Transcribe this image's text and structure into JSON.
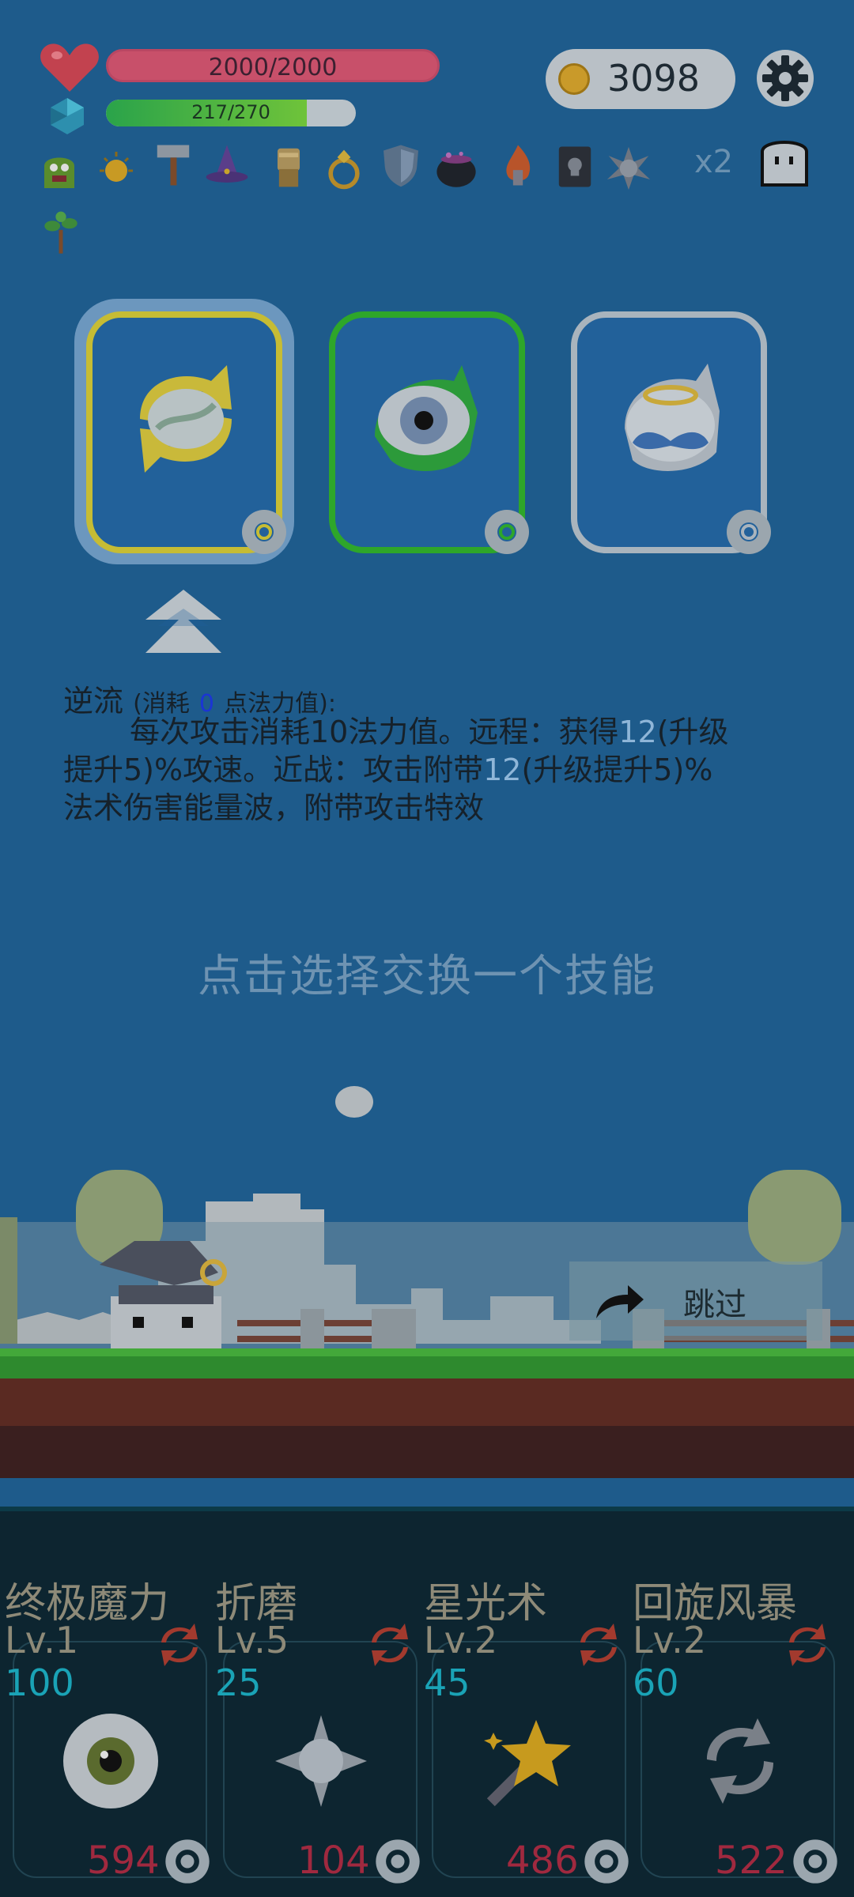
{
  "hud": {
    "hp_text": "2000/2000",
    "hp_fraction": 1.0,
    "mp_text": "217/270",
    "mp_fraction": 0.8037,
    "coins": "3098",
    "multiplier": "x2"
  },
  "equipment": [
    {
      "icon": "green-monster-icon"
    },
    {
      "icon": "sun-orb-icon"
    },
    {
      "icon": "hammer-icon"
    },
    {
      "icon": "wizard-hat-icon"
    },
    {
      "icon": "gauntlet-icon"
    },
    {
      "icon": "ring-icon"
    },
    {
      "icon": "shield-icon"
    },
    {
      "icon": "cauldron-icon"
    },
    {
      "icon": "flame-icon"
    },
    {
      "icon": "skull-book-icon"
    },
    {
      "icon": "spiked-ball-icon"
    },
    {
      "icon": "sapling-icon"
    }
  ],
  "choices": [
    {
      "icon": "reverse-flow-icon",
      "border": "#c6bc34"
    },
    {
      "icon": "eye-icon",
      "border": "#2ea62a"
    },
    {
      "icon": "angel-mustache-icon",
      "border": "#a9b4bd"
    }
  ],
  "description": {
    "name": "逆流",
    "cost_prefix": "(消耗",
    "cost_value": "0",
    "cost_suffix": "点法力值):",
    "line1_a": "每次攻击消耗10法力值。远程：获得",
    "line1_hl": "12",
    "line1_b": "(升级",
    "line2_a": "提升5)%攻速。近战：攻击附带",
    "line2_hl": "12",
    "line2_b": "(升级提升5)%",
    "line3": "法术伤害能量波，附带攻击特效"
  },
  "prompt": "点击选择交换一个技能",
  "skip_label": "跳过",
  "slots": [
    {
      "name": "终极魔力",
      "level": "Lv.1",
      "cost": "100",
      "count": "594",
      "icon": "eyeball-icon"
    },
    {
      "name": "折磨",
      "level": "Lv.5",
      "cost": "25",
      "count": "104",
      "icon": "spiked-mace-icon"
    },
    {
      "name": "星光术",
      "level": "Lv.2",
      "cost": "45",
      "count": "486",
      "icon": "star-wand-icon"
    },
    {
      "name": "回旋风暴",
      "level": "Lv.2",
      "cost": "60",
      "count": "522",
      "icon": "whirlwind-icon"
    }
  ]
}
